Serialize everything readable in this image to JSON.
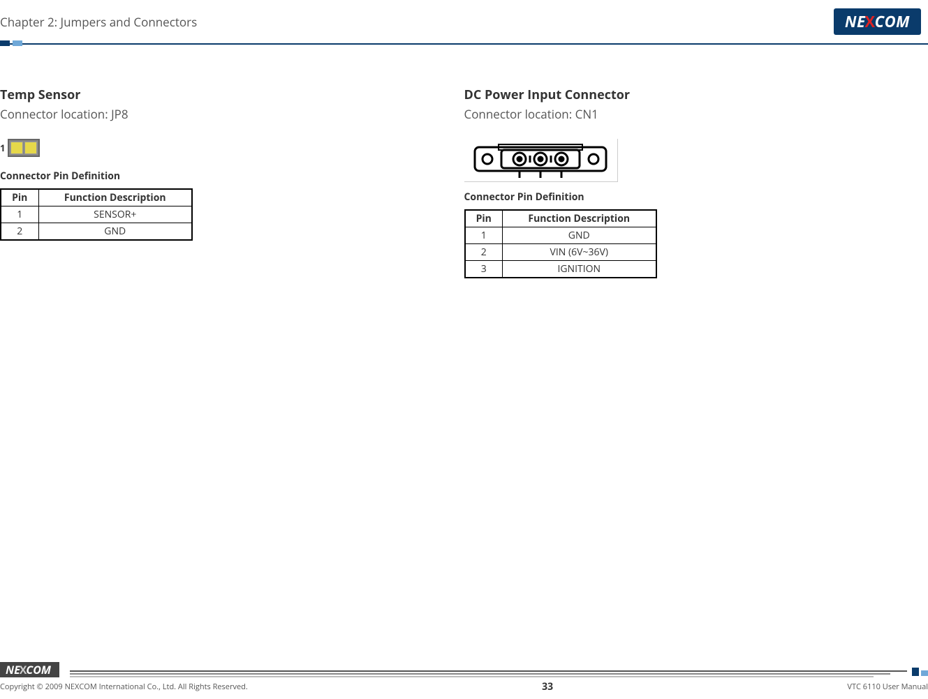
{
  "header": {
    "chapter": "Chapter 2: Jumpers and Connectors",
    "logo_pre": "NE",
    "logo_x": "X",
    "logo_post": "COM"
  },
  "left": {
    "title": "Temp Sensor",
    "location": "Connector location: JP8",
    "pin_marker": "1",
    "table_title": "Connector Pin Definition",
    "headers": {
      "pin": "Pin",
      "desc": "Function Description"
    },
    "rows": [
      {
        "pin": "1",
        "desc": "SENSOR+"
      },
      {
        "pin": "2",
        "desc": "GND"
      }
    ]
  },
  "right": {
    "title": "DC Power Input Connector",
    "location": "Connector location: CN1",
    "table_title": "Connector Pin Definition",
    "headers": {
      "pin": "Pin",
      "desc": "Function Description"
    },
    "rows": [
      {
        "pin": "1",
        "desc": "GND"
      },
      {
        "pin": "2",
        "desc": "VIN (6V~36V)"
      },
      {
        "pin": "3",
        "desc": "IGNITION"
      }
    ]
  },
  "footer": {
    "logo_pre": "NE",
    "logo_x": "X",
    "logo_post": "COM",
    "copyright": "Copyright © 2009 NEXCOM International Co., Ltd. All Rights Reserved.",
    "page": "33",
    "manual": "VTC 6110 User Manual"
  }
}
